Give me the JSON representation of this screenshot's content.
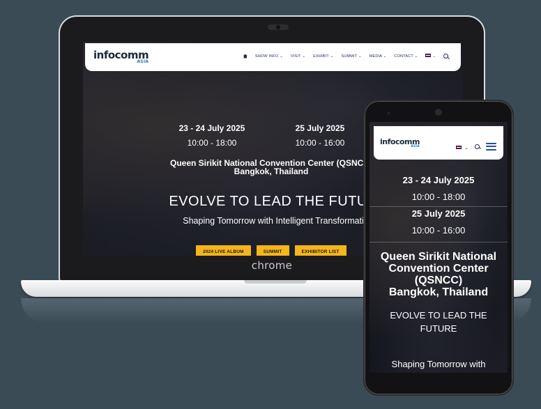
{
  "laptop": {
    "brand": "chrome",
    "nav": {
      "logo": "infocomm",
      "logo_sub": "ASIA",
      "items": [
        "SHOW INFO",
        "VISIT",
        "EXHIBIT",
        "SUMMIT",
        "MEDIA",
        "CONTACT"
      ],
      "caret": "⌄"
    },
    "hero": {
      "date1": "23 - 24 July 2025",
      "time1": "10:00 - 18:00",
      "date2": "25 July 2025",
      "time2": "10:00 - 16:00",
      "venue_line1": "Queen Sirikit National Convention Center (QSNCC)",
      "venue_line2": "Bangkok, Thailand",
      "headline": "EVOLVE TO LEAD THE FUTURE",
      "tagline": "Shaping Tomorrow with Intelligent Transformation",
      "buttons": [
        "2024 LIVE ALBUM",
        "SUMMIT",
        "EXHIBITOR LIST"
      ]
    }
  },
  "phone": {
    "nav": {
      "logo": "infocomm",
      "logo_sub": "ASIA",
      "caret": "⌄"
    },
    "hero": {
      "date1": "23 - 24 July 2025",
      "time1": "10:00 - 18:00",
      "date2": "25 July 2025",
      "time2": "10:00 - 16:00",
      "venue_line1": "Queen Sirikit National",
      "venue_line2": "Convention Center",
      "venue_line3": "(QSNCC)",
      "venue_line4": "Bangkok, Thailand",
      "headline_line1": "EVOLVE TO LEAD THE",
      "headline_line2": "FUTURE",
      "tagline": "Shaping Tomorrow with"
    }
  },
  "colors": {
    "background": "#3a4b55",
    "button": "#f5b51b",
    "logo_accent": "#1e7ac8"
  }
}
